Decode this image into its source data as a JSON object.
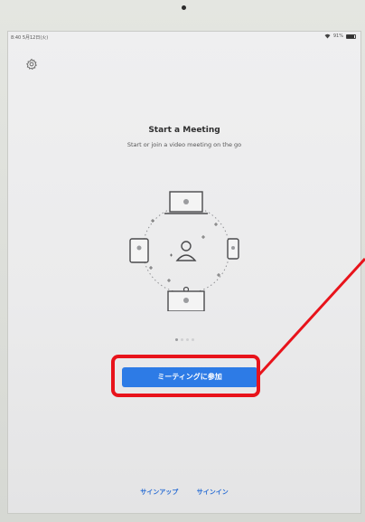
{
  "status_bar": {
    "time": "8:40  5月12日(火)",
    "battery": "91%"
  },
  "main": {
    "title": "Start a Meeting",
    "subtitle": "Start or join a video meeting on the go",
    "join_label": "ミーティングに参加",
    "carousel_active_page": 1,
    "carousel_page_count": 4
  },
  "footer": {
    "signup_label": "サインアップ",
    "signin_label": "サインイン"
  },
  "colors": {
    "primary_button": "#2d7be6",
    "link": "#2d6fd4",
    "annotation": "#e8131b"
  },
  "icons": [
    "gear-icon",
    "wifi-icon",
    "battery-icon",
    "laptop-icon",
    "tablet-icon",
    "phone-icon",
    "user-icon",
    "webcam-screen-icon"
  ]
}
